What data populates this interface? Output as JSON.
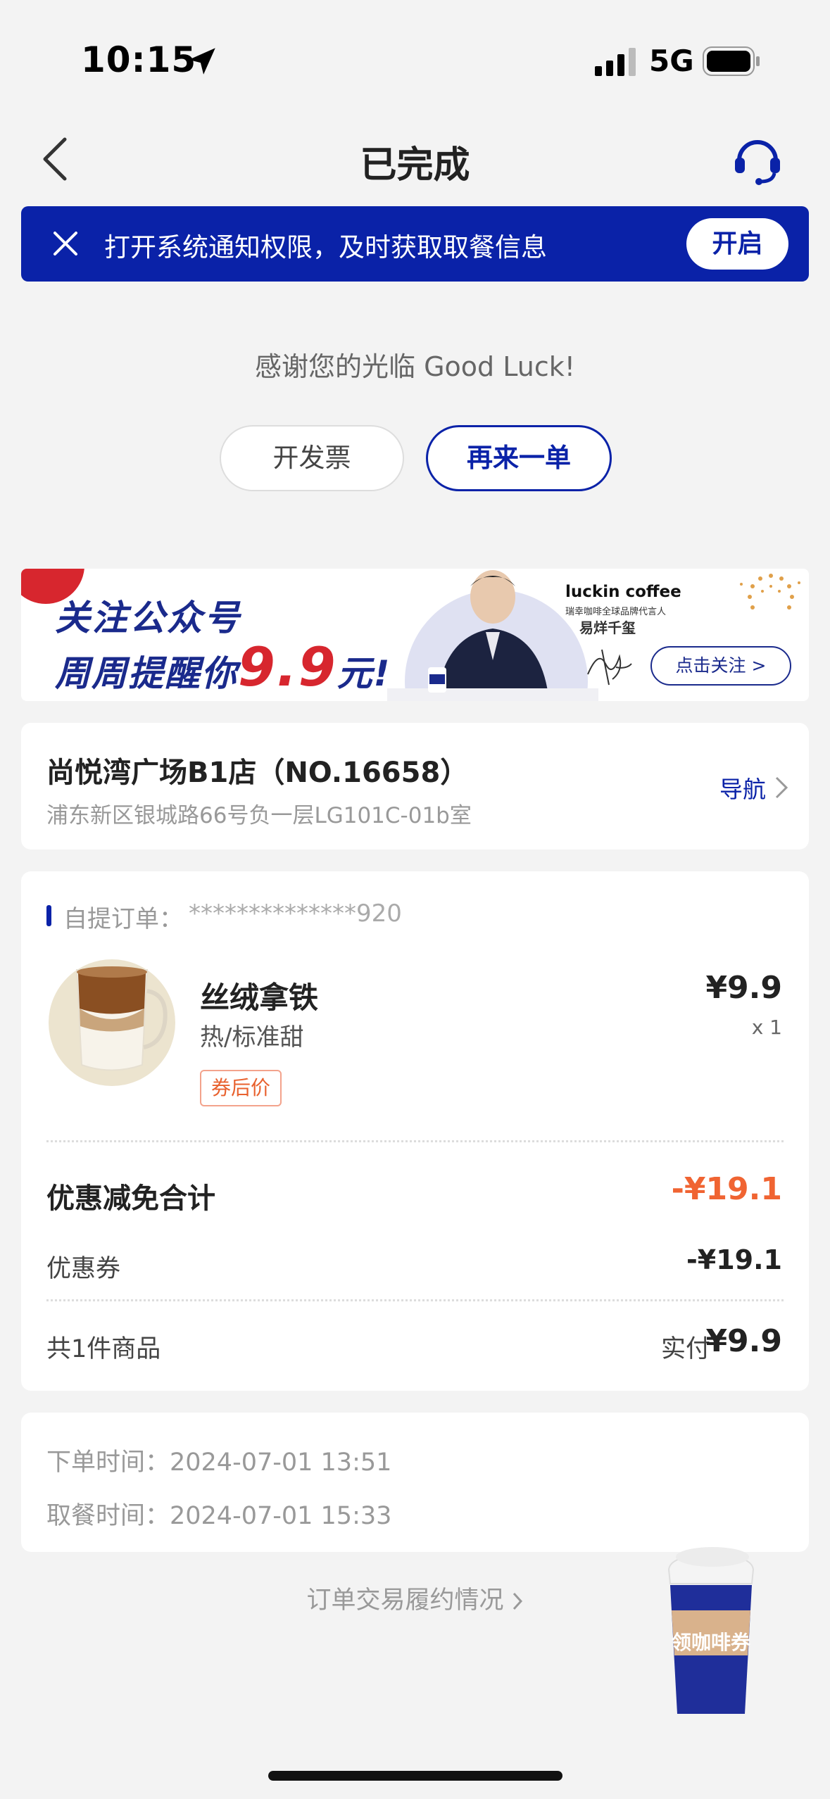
{
  "status_bar": {
    "time": "10:15",
    "network": "5G"
  },
  "header": {
    "title": "已完成"
  },
  "notice": {
    "text": "打开系统通知权限，及时获取取餐信息",
    "button": "开启"
  },
  "thanks": "感谢您的光临 Good Luck!",
  "actions": {
    "invoice": "开发票",
    "reorder": "再来一单"
  },
  "ad": {
    "line1": "关注公众号",
    "line2_prefix": "周周提醒你",
    "price": "9.9",
    "line2_suffix": "元!",
    "brand": "luckin coffee",
    "brand_sub": "瑞幸咖啡全球品牌代言人",
    "ambassador": "易烊千玺",
    "follow": "点击关注 >"
  },
  "store": {
    "name": "尚悦湾广场B1店（NO.16658）",
    "address": "浦东新区银城路66号负一层LG101C-01b室",
    "nav": "导航"
  },
  "order": {
    "label": "自提订单：",
    "id": "**************920",
    "product": {
      "name": "丝绒拿铁",
      "spec": "热/标准甜",
      "tag": "券后价",
      "price": "¥9.9",
      "qty": "x 1"
    },
    "discount_title": "优惠减免合计",
    "discount_total": "-¥19.1",
    "coupon_label": "优惠券",
    "coupon_value": "-¥19.1",
    "count": "共1件商品",
    "paid_label": "实付",
    "paid_value": "¥9.9"
  },
  "times": {
    "order_time": "下单时间：2024-07-01 13:51",
    "pickup_time": "取餐时间：2024-07-01 15:33"
  },
  "fulfilment": "订单交易履约情况",
  "float_cup": "领咖啡券",
  "colors": {
    "brand_blue": "#0a22a8",
    "discount_orange": "#f06432",
    "background": "#f3f3f3"
  }
}
